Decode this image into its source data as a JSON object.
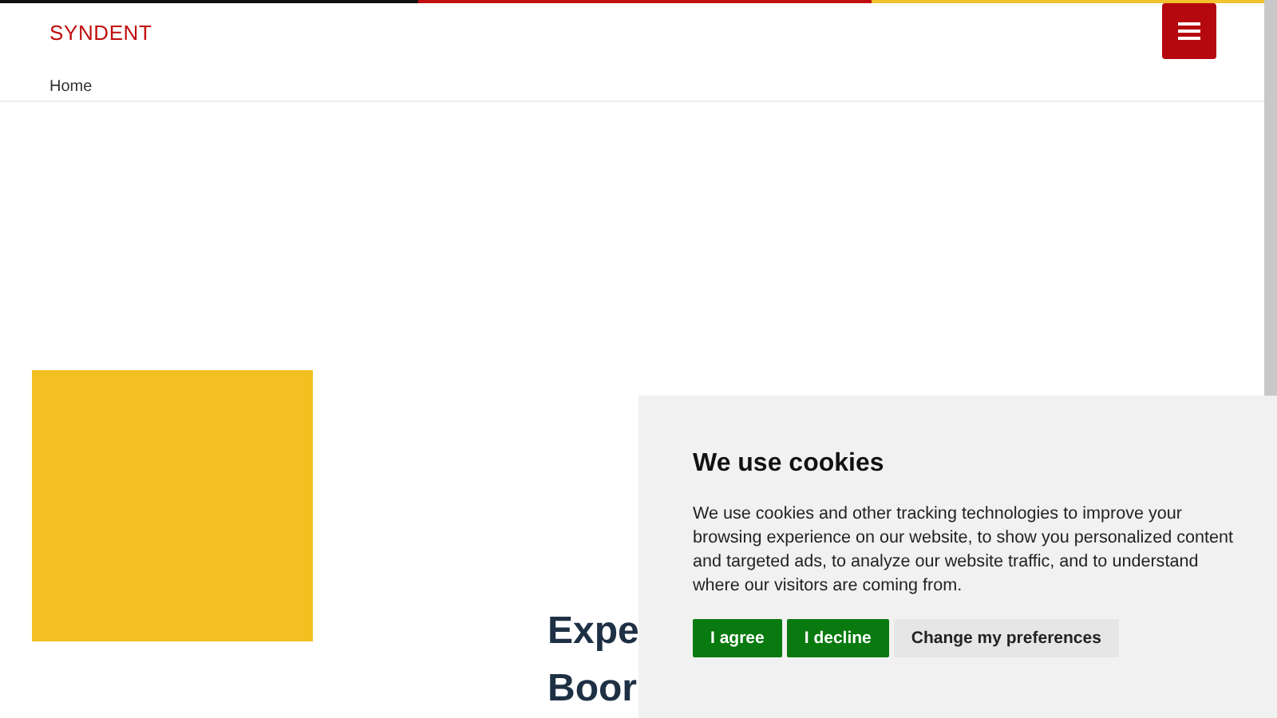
{
  "header": {
    "logo": "SYNDENT"
  },
  "breadcrumb": [
    "Home"
  ],
  "heading_lines": [
    "Expe",
    "Boor"
  ],
  "cookie_banner": {
    "title": "We use cookies",
    "text": "We use cookies and other tracking technologies to improve your browsing experience on our website, to show you personalized content and targeted ads, to analyze our website traffic, and to understand where our visitors are coming from.",
    "buttons": [
      {
        "label": "I agree",
        "kind": "primary"
      },
      {
        "label": "I decline",
        "kind": "primary"
      },
      {
        "label": "Change my preferences",
        "kind": "secondary"
      }
    ]
  }
}
